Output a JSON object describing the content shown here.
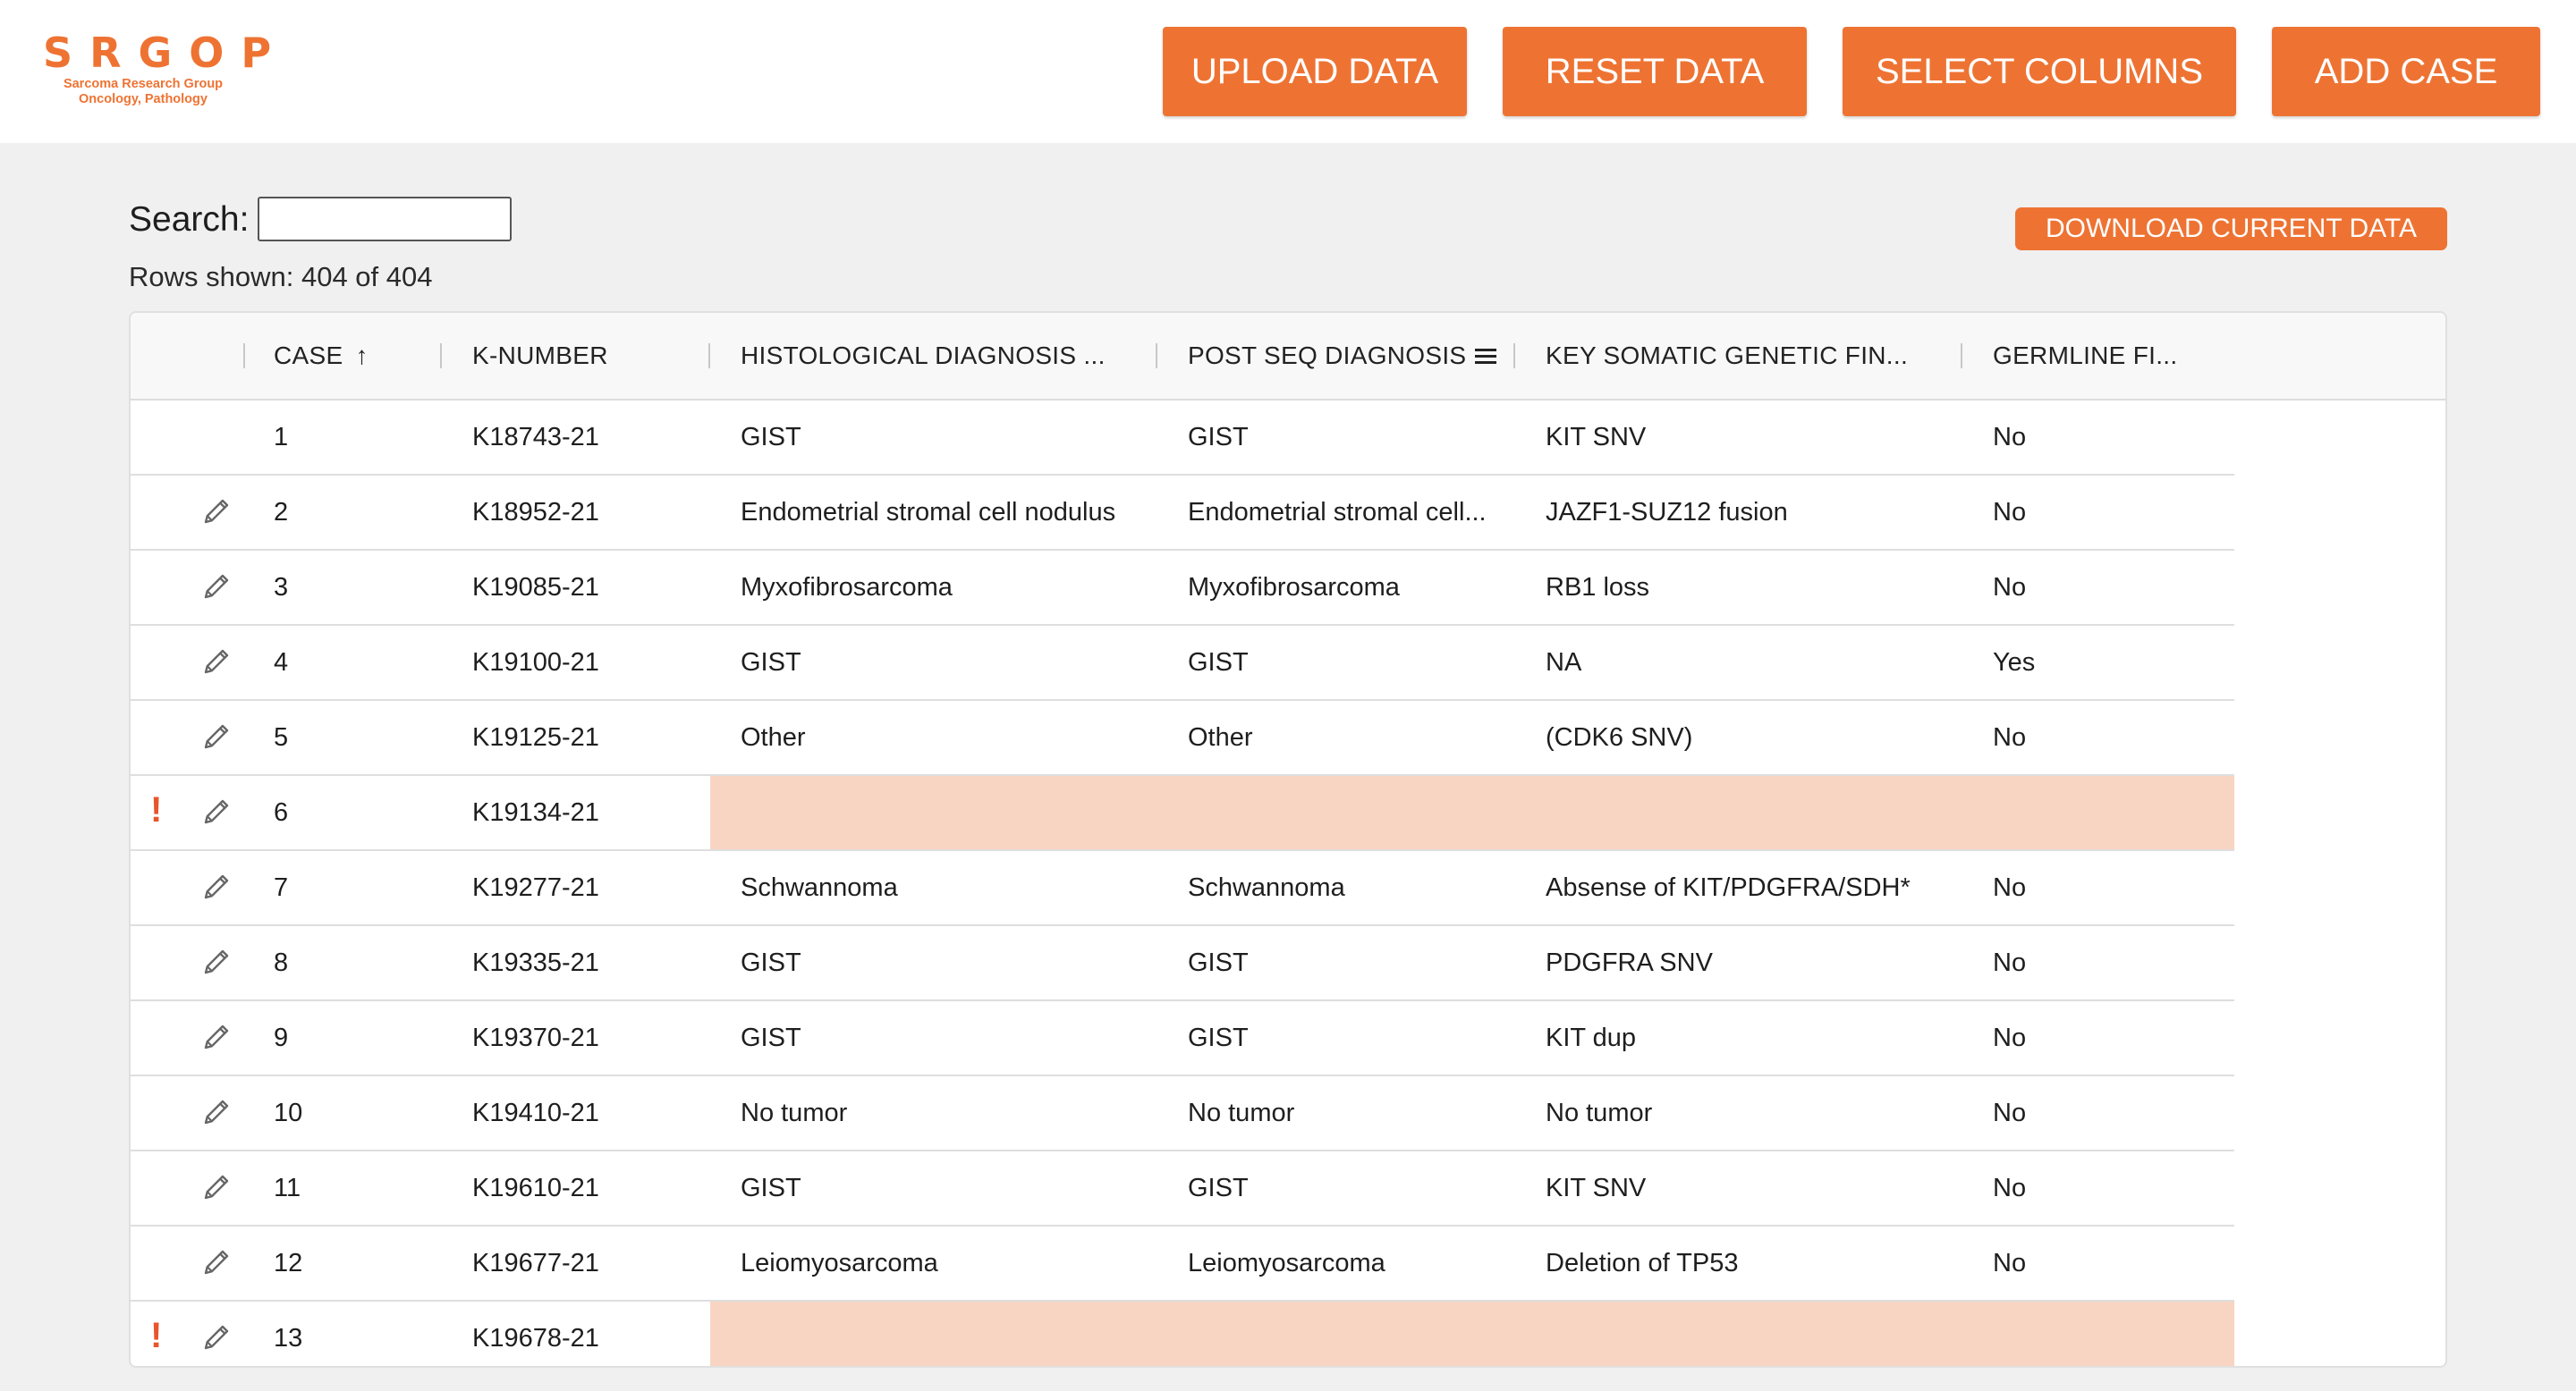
{
  "logo": {
    "text": "SRGOP",
    "subtitle_line1": "Sarcoma Research Group",
    "subtitle_line2": "Oncology, Pathology"
  },
  "header": {
    "upload_label": "UPLOAD DATA",
    "reset_label": "RESET DATA",
    "select_columns_label": "SELECT COLUMNS",
    "add_case_label": "ADD CASE"
  },
  "search": {
    "label": "Search:",
    "value": ""
  },
  "rows_shown": "Rows shown: 404 of 404",
  "download_label": "DOWNLOAD CURRENT DATA",
  "accent_color": "#ee7333",
  "highlight_color": "#f8d5c2",
  "table": {
    "columns": [
      "CASE",
      "K-NUMBER",
      "HISTOLOGICAL DIAGNOSIS ...",
      "POST SEQ DIAGNOSIS",
      "KEY SOMATIC GENETIC FIN...",
      "GERMLINE FI..."
    ],
    "sort_indicator": "↑",
    "rows": [
      {
        "case": "1",
        "k": "K18743-21",
        "hist": "GIST",
        "post": "GIST",
        "key": "KIT SNV",
        "germ": "No",
        "edit": false,
        "warn": false
      },
      {
        "case": "2",
        "k": "K18952-21",
        "hist": "Endometrial stromal cell nodulus",
        "post": "Endometrial stromal cell...",
        "key": "JAZF1-SUZ12 fusion",
        "germ": "No",
        "edit": true,
        "warn": false
      },
      {
        "case": "3",
        "k": "K19085-21",
        "hist": "Myxofibrosarcoma",
        "post": "Myxofibrosarcoma",
        "key": "RB1 loss",
        "germ": "No",
        "edit": true,
        "warn": false
      },
      {
        "case": "4",
        "k": "K19100-21",
        "hist": "GIST",
        "post": "GIST",
        "key": "NA",
        "germ": "Yes",
        "edit": true,
        "warn": false
      },
      {
        "case": "5",
        "k": "K19125-21",
        "hist": "Other",
        "post": "Other",
        "key": "(CDK6 SNV)",
        "germ": "No",
        "edit": true,
        "warn": false
      },
      {
        "case": "6",
        "k": "K19134-21",
        "hist": "",
        "post": "",
        "key": "",
        "germ": "",
        "edit": true,
        "warn": true
      },
      {
        "case": "7",
        "k": "K19277-21",
        "hist": "Schwannoma",
        "post": "Schwannoma",
        "key": "Absense of KIT/PDGFRA/SDH*",
        "germ": "No",
        "edit": true,
        "warn": false
      },
      {
        "case": "8",
        "k": "K19335-21",
        "hist": "GIST",
        "post": "GIST",
        "key": "PDGFRA SNV",
        "germ": "No",
        "edit": true,
        "warn": false
      },
      {
        "case": "9",
        "k": "K19370-21",
        "hist": "GIST",
        "post": "GIST",
        "key": "KIT dup",
        "germ": "No",
        "edit": true,
        "warn": false
      },
      {
        "case": "10",
        "k": "K19410-21",
        "hist": "No tumor",
        "post": "No tumor",
        "key": "No tumor",
        "germ": "No",
        "edit": true,
        "warn": false
      },
      {
        "case": "11",
        "k": "K19610-21",
        "hist": "GIST",
        "post": "GIST",
        "key": "KIT SNV",
        "germ": "No",
        "edit": true,
        "warn": false
      },
      {
        "case": "12",
        "k": "K19677-21",
        "hist": "Leiomyosarcoma",
        "post": "Leiomyosarcoma",
        "key": "Deletion of TP53",
        "germ": "No",
        "edit": true,
        "warn": false
      },
      {
        "case": "13",
        "k": "K19678-21",
        "hist": "",
        "post": "",
        "key": "",
        "germ": "",
        "edit": true,
        "warn": true
      }
    ]
  }
}
